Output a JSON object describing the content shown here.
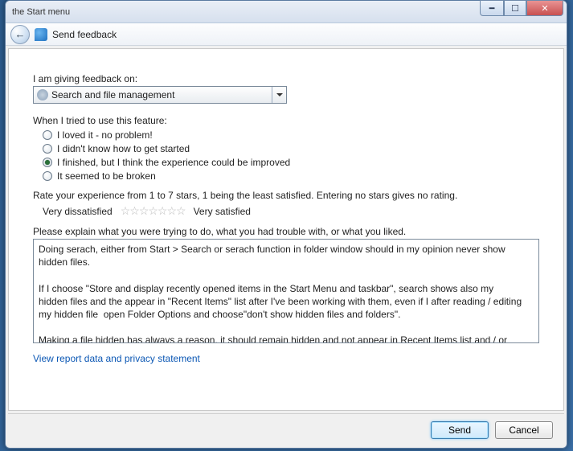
{
  "window": {
    "title_fragment": "the Start menu"
  },
  "toolbar": {
    "label": "Send feedback"
  },
  "form": {
    "topic_label": "I am giving feedback on:",
    "topic_value": "Search and file management",
    "exp_label": "When I tried to use this feature:",
    "options": [
      {
        "label": "I loved it - no problem!",
        "checked": false
      },
      {
        "label": "I didn't know how to get started",
        "checked": false
      },
      {
        "label": "I finished, but I think the experience could be improved",
        "checked": true
      },
      {
        "label": "It seemed to be broken",
        "checked": false
      }
    ],
    "rate_label": "Rate your experience from 1 to 7 stars, 1 being the least satisfied.  Entering no stars gives no rating.",
    "very_dis": "Very dissatisfied",
    "very_sat": "Very satisfied",
    "stars": "☆☆☆☆☆☆☆",
    "explain_label": "Please explain what you were trying to do, what you had trouble with, or what you liked.",
    "explain_value": "Doing serach, either from Start > Search or serach function in folder window should in my opinion never show hidden files.\n\nIf I choose \"Store and display recently opened items in the Start Menu and taskbar\", search shows also my hidden files and the appear in \"Recent Items\" list after I've been working with them, even if I after reading / editing my hidden file  open Folder Options and choose\"don't show hidden files and folders\".\n\nMaking a file hidden has always a reason, it should remain hidden and not appear in Recent Items list and / or search.",
    "privacy_link": "View report data and privacy statement"
  },
  "footer": {
    "send": "Send",
    "cancel": "Cancel"
  }
}
